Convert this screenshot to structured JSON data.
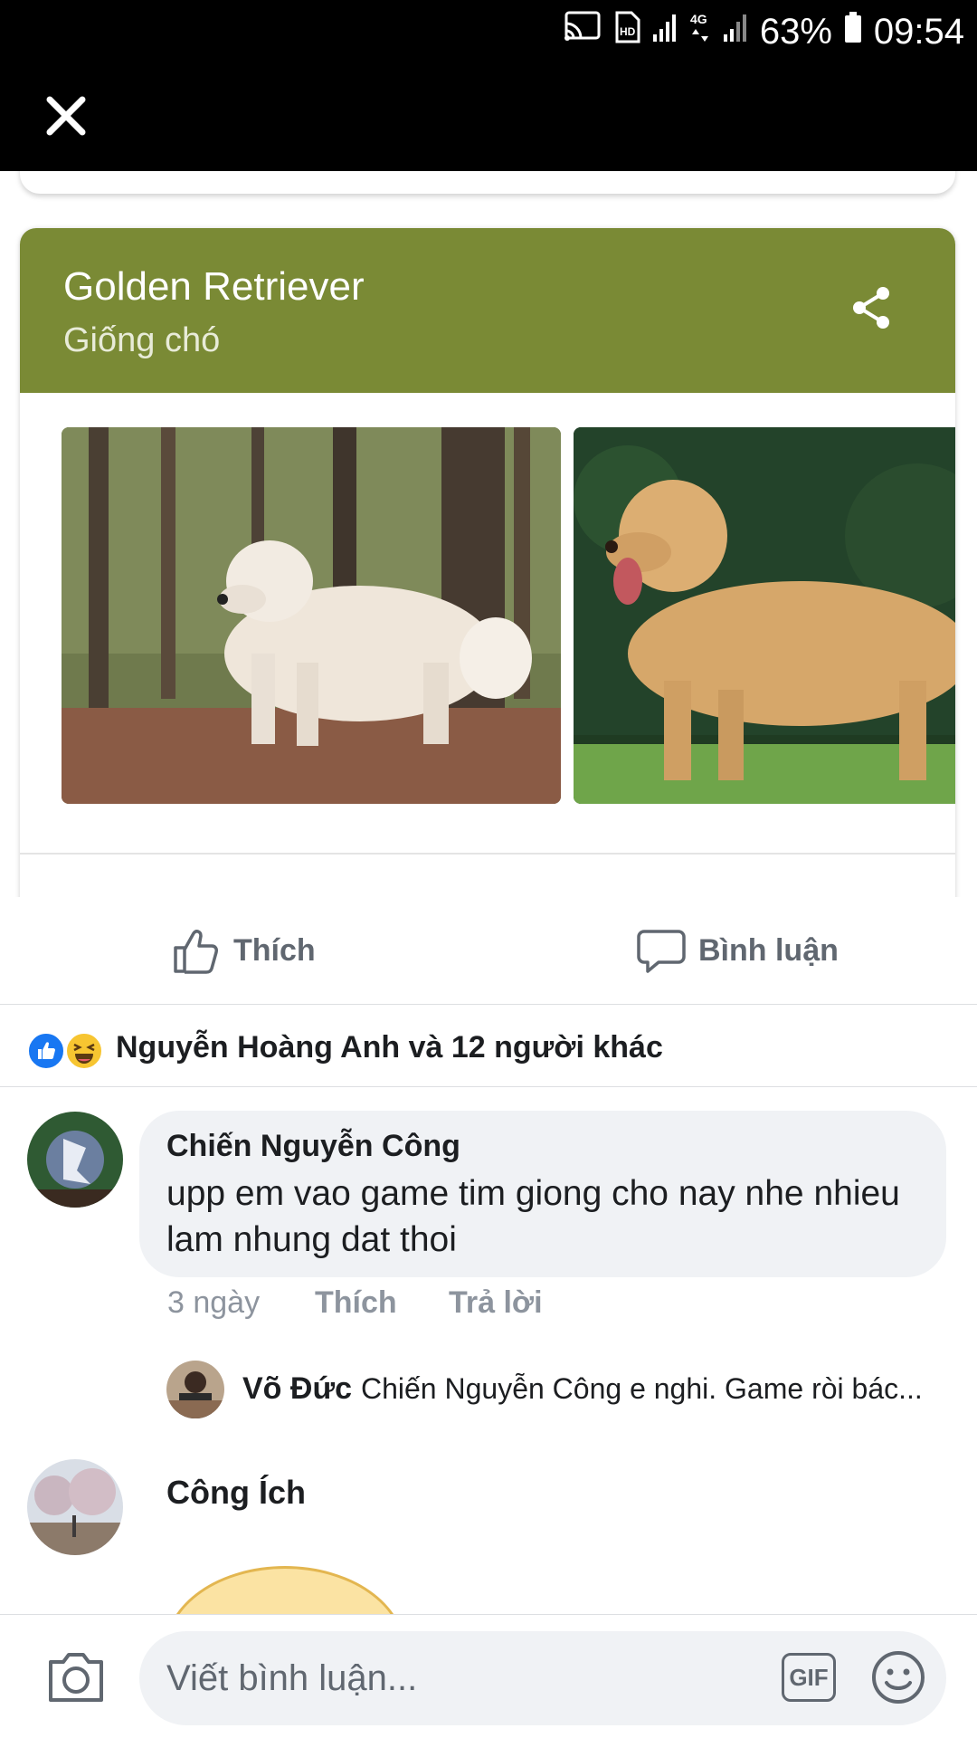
{
  "status_bar": {
    "battery": "63%",
    "time": "09:54",
    "network": "4G",
    "icons": [
      "cast-icon",
      "hd-icon",
      "signal-icon",
      "network-4g-icon",
      "signal-icon",
      "battery-icon"
    ]
  },
  "header": {
    "close_icon": "close-icon"
  },
  "knowledge_card": {
    "title": "Golden Retriever",
    "subtitle": "Giống chó",
    "share_icon": "share-icon",
    "header_color": "#7a8a35"
  },
  "actions": {
    "like_label": "Thích",
    "comment_label": "Bình luận"
  },
  "reactions": {
    "text": "Nguyễn Hoàng Anh và 12 người khác",
    "icons": [
      "like-reaction-icon",
      "haha-reaction-icon"
    ]
  },
  "comments": [
    {
      "author": "Chiến Nguyễn Công",
      "text": "upp em vao game tim giong cho nay nhe nhieu lam nhung dat thoi",
      "time": "3 ngày",
      "like_label": "Thích",
      "reply_label": "Trả lời",
      "reply_preview": {
        "author": "Võ Đức",
        "text": "Chiến Nguyễn Công e nghi. Game ròi bác..."
      }
    },
    {
      "author": "Công Ích"
    }
  ],
  "composer": {
    "placeholder": "Viết bình luận...",
    "gif_label": "GIF"
  },
  "colors": {
    "facebook_blue": "#1877f2",
    "text_primary": "#1c1e21",
    "text_secondary": "#606770",
    "bubble_bg": "#f0f2f5"
  }
}
